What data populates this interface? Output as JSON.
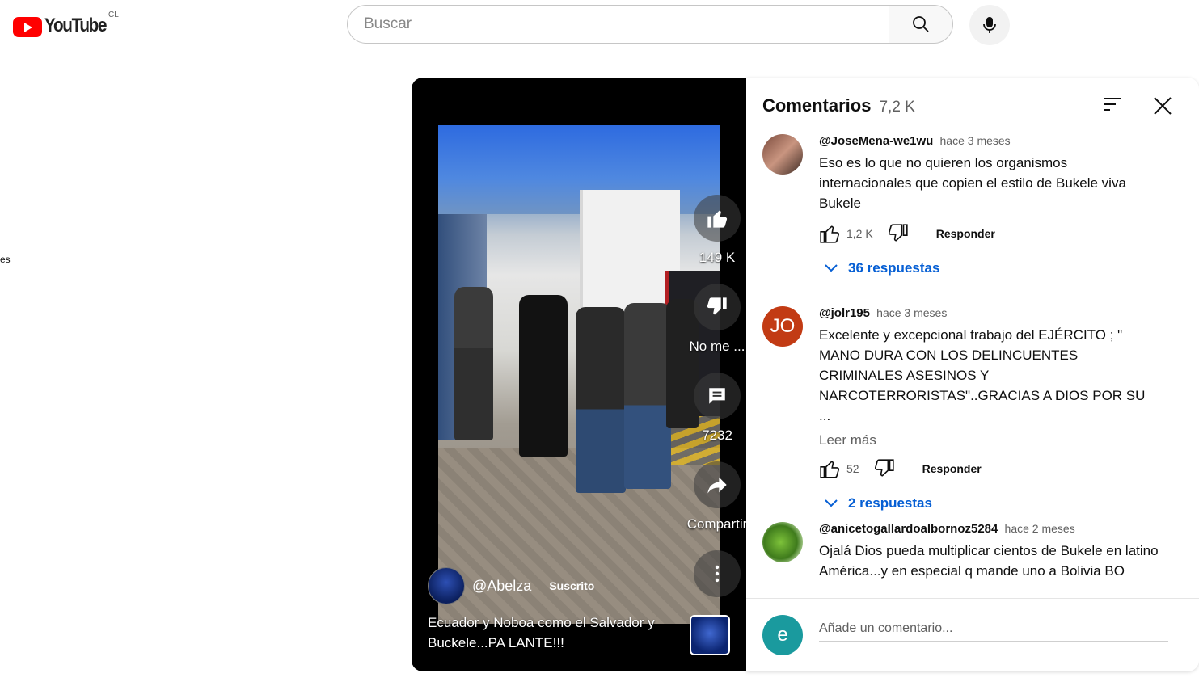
{
  "header": {
    "logo_text": "YouTube",
    "country_code": "CL",
    "search_placeholder": "Buscar"
  },
  "edge_text": "es",
  "player": {
    "actions": {
      "like_count": "149 K",
      "dislike_label": "No me ...",
      "comments_count": "7232",
      "share_label": "Compartir"
    },
    "channel": {
      "handle": "@Abelza",
      "subscribed_label": "Suscrito"
    },
    "caption": "Ecuador y Noboa como el Salvador y Buckele...PA LANTE!!!"
  },
  "comments_panel": {
    "title": "Comentarios",
    "count": "7,2 K",
    "comments": [
      {
        "author": "@JoseMena-we1wu",
        "time": "hace 3 meses",
        "text": "Eso es lo que no quieren los organismos internacionales que copien el estilo de Bukele viva Bukele",
        "likes": "1,2 K",
        "reply_label": "Responder",
        "replies_label": "36 respuestas"
      },
      {
        "author": "@jolr195",
        "time": "hace 3 meses",
        "avatar_initials": "JO",
        "text": "Excelente y excepcional trabajo del EJÉRCITO  ; \" MANO DURA CON LOS DELINCUENTES CRIMINALES ASESINOS Y NARCOTERRORISTAS\"..GRACIAS A DIOS POR SU ...",
        "read_more": "Leer más",
        "likes": "52",
        "reply_label": "Responder",
        "replies_label": "2 respuestas"
      },
      {
        "author": "@anicetogallardoalbornoz5284",
        "time": "hace 2 meses",
        "text": "Ojalá Dios pueda multiplicar cientos de Bukele en latino América...y en especial q mande uno a Bolivia BO"
      }
    ],
    "add_comment": {
      "avatar_initial": "e",
      "placeholder": "Añade un comentario..."
    }
  },
  "colors": {
    "brand_red": "#ff0000",
    "link_blue": "#065fd4",
    "jo_avatar": "#c23b14",
    "me_avatar": "#1a9a9e"
  }
}
